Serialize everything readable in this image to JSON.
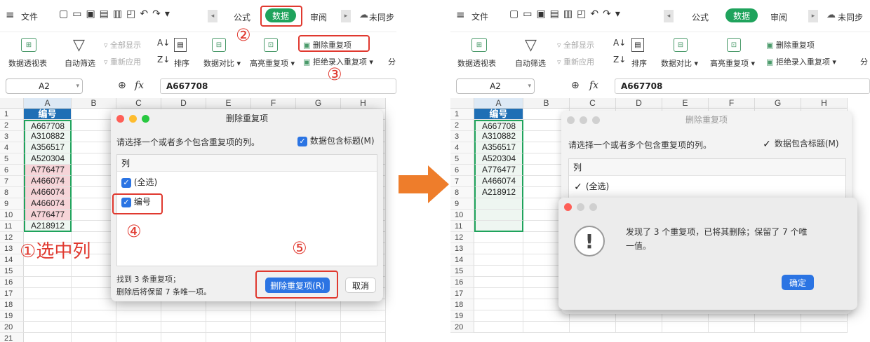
{
  "menu": {
    "file": "文件",
    "tabs": [
      "公式",
      "数据",
      "审阅"
    ],
    "sync": "未同步"
  },
  "ribbon": {
    "pivot": "数据透视表",
    "autofilter": "自动筛选",
    "show_all": "全部显示",
    "reapply": "重新应用",
    "sort": "排序",
    "compare": "数据对比",
    "highlight_dup": "高亮重复项",
    "delete_dup": "删除重复项",
    "reject_dup": "拒绝录入重复项",
    "split": "分"
  },
  "formula_bar": {
    "cell_ref": "A2",
    "fx": "fx",
    "value": "A667708"
  },
  "sheet": {
    "columns": [
      "A",
      "B",
      "C",
      "D",
      "E",
      "F",
      "G",
      "H"
    ],
    "header": "编号",
    "left_values": [
      "A667708",
      "A310882",
      "A356517",
      "A520304",
      "A776477",
      "A466074",
      "A466074",
      "A466074",
      "A776477",
      "A218912"
    ],
    "right_values": [
      "A667708",
      "A310882",
      "A356517",
      "A520304",
      "A776477",
      "A466074",
      "A218912"
    ],
    "left_rows": [
      "1",
      "2",
      "3",
      "4",
      "5",
      "6",
      "7",
      "8",
      "9",
      "10",
      "11",
      "12",
      "13",
      "14",
      "15",
      "16",
      "17",
      "18",
      "19",
      "20",
      "21"
    ],
    "right_rows": [
      "1",
      "2",
      "3",
      "4",
      "5",
      "6",
      "7",
      "8",
      "9",
      "10",
      "11",
      "12",
      "13",
      "14",
      "15",
      "16",
      "17",
      "18",
      "19",
      "20"
    ],
    "duplicate_color": "#f6d4d8"
  },
  "dialog": {
    "title": "删除重复项",
    "prompt": "请选择一个或者多个包含重复项的列。",
    "has_header": "数据包含标题(M)",
    "list_header": "列",
    "select_all": "(全选)",
    "col_item": "编号",
    "found": "找到 3 条重复项；",
    "keep": "删除后将保留 7 条唯一项。",
    "delete_btn": "删除重复项(R)",
    "cancel_btn": "取消"
  },
  "alert": {
    "message_1": "发现了 3 个重复项，已将其删除；保留了 7 个唯",
    "message_2": "一值。",
    "ok": "确定"
  },
  "annotations": {
    "n1": "①",
    "step1": "选中列",
    "n2": "②",
    "n3": "③",
    "n4": "④",
    "n5": "⑤"
  },
  "colors": {
    "accent_green": "#1fa35c",
    "annotation_red": "#e0392f",
    "primary_blue": "#2b74e3",
    "arrow_orange": "#ee7d2b",
    "header_blue": "#1f6fb5"
  }
}
